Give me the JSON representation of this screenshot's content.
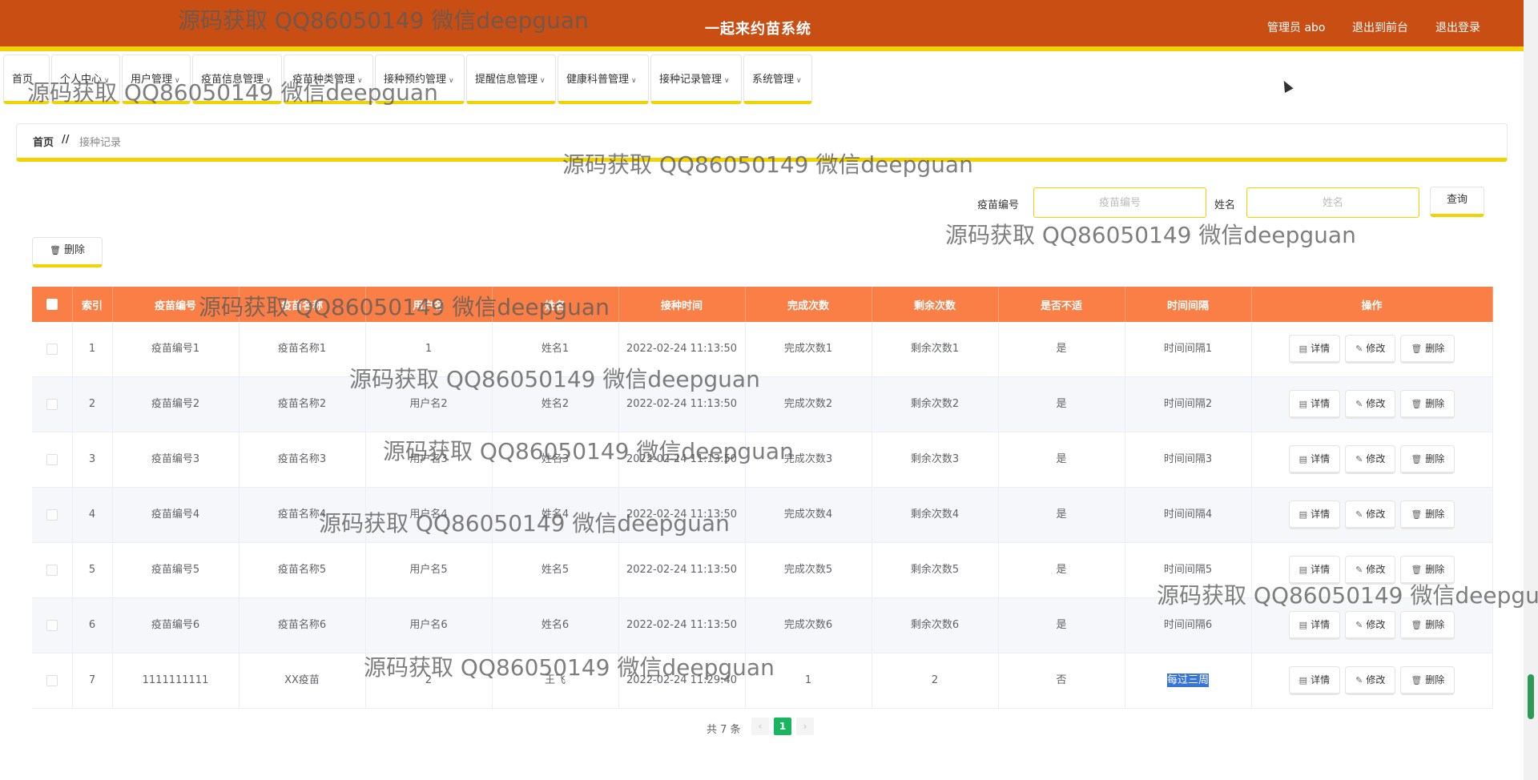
{
  "header": {
    "title": "一起来约苗系统",
    "admin": "管理员 abo",
    "front_link": "退出到前台",
    "logout_link": "退出登录"
  },
  "nav": {
    "items": [
      {
        "label": "首页",
        "dropdown": false
      },
      {
        "label": "个人中心",
        "dropdown": true
      },
      {
        "label": "用户管理",
        "dropdown": true
      },
      {
        "label": "疫苗信息管理",
        "dropdown": true
      },
      {
        "label": "疫苗种类管理",
        "dropdown": true
      },
      {
        "label": "接种预约管理",
        "dropdown": true
      },
      {
        "label": "提醒信息管理",
        "dropdown": true
      },
      {
        "label": "健康科普管理",
        "dropdown": true
      },
      {
        "label": "接种记录管理",
        "dropdown": true
      },
      {
        "label": "系统管理",
        "dropdown": true
      }
    ]
  },
  "breadcrumb": {
    "home": "首页",
    "separator": "//",
    "current": "接种记录"
  },
  "search": {
    "vaccine_no_label": "疫苗编号",
    "vaccine_no_placeholder": "疫苗编号",
    "name_label": "姓名",
    "name_placeholder": "姓名",
    "query_button": "查询"
  },
  "toolbar": {
    "delete_button": "删除"
  },
  "table": {
    "headers": [
      "索引",
      "疫苗编号",
      "疫苗名称",
      "用户名",
      "姓名",
      "接种时间",
      "完成次数",
      "剩余次数",
      "是否不适",
      "时间间隔",
      "操作"
    ],
    "rows": [
      [
        "1",
        "疫苗编号1",
        "疫苗名称1",
        "1",
        "姓名1",
        "2022-02-24 11:13:50",
        "完成次数1",
        "剩余次数1",
        "是",
        "时间间隔1"
      ],
      [
        "2",
        "疫苗编号2",
        "疫苗名称2",
        "用户名2",
        "姓名2",
        "2022-02-24 11:13:50",
        "完成次数2",
        "剩余次数2",
        "是",
        "时间间隔2"
      ],
      [
        "3",
        "疫苗编号3",
        "疫苗名称3",
        "用户名3",
        "姓名3",
        "2022-02-24 11:13:50",
        "完成次数3",
        "剩余次数3",
        "是",
        "时间间隔3"
      ],
      [
        "4",
        "疫苗编号4",
        "疫苗名称4",
        "用户名4",
        "姓名4",
        "2022-02-24 11:13:50",
        "完成次数4",
        "剩余次数4",
        "是",
        "时间间隔4"
      ],
      [
        "5",
        "疫苗编号5",
        "疫苗名称5",
        "用户名5",
        "姓名5",
        "2022-02-24 11:13:50",
        "完成次数5",
        "剩余次数5",
        "是",
        "时间间隔5"
      ],
      [
        "6",
        "疫苗编号6",
        "疫苗名称6",
        "用户名6",
        "姓名6",
        "2022-02-24 11:13:50",
        "完成次数6",
        "剩余次数6",
        "是",
        "时间间隔6"
      ],
      [
        "7",
        "1111111111",
        "XX疫苗",
        "2",
        "王飞",
        "2022-02-24 11:29:40",
        "1",
        "2",
        "否",
        "每过三周"
      ]
    ],
    "actions": {
      "detail": "详情",
      "edit": "修改",
      "delete": "删除"
    }
  },
  "pagination": {
    "total": "共 7 条",
    "current_page": "1",
    "prev": "‹",
    "next": "›"
  },
  "watermark_text": "源码获取 QQ86050149 微信deepguan",
  "colors": {
    "header_bg": "#c94e14",
    "accent_yellow": "#f2d200",
    "table_header": "#fa7f46",
    "page_active": "#19b55f"
  }
}
